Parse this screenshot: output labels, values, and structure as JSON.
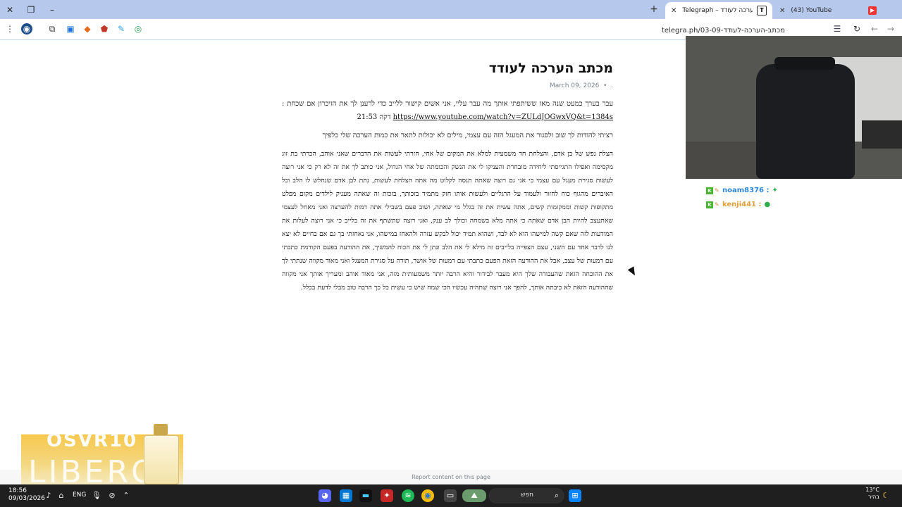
{
  "browser": {
    "tabs": [
      {
        "title": "Telegraph – מכתב הערכה לעודד",
        "favicon": "T",
        "active": true
      },
      {
        "title": "(43) YouTube",
        "favicon": "▶",
        "active": false
      }
    ],
    "url": "telegra.ph/03-09-מכתב-הערכה-לעודד",
    "new_tab": "+"
  },
  "article": {
    "title": "מכתב הערכה לעודד",
    "date": "March 09, 2026",
    "p1_text": "עבר בערך כמעט שנה מאז ששיתפתי אותך מה עבר עליי, אני אשים קישור ללייב כדי לרענן לך את הזיכרון אם שכחת :",
    "p1_link": "https://www.youtube.com/watch?v=ZULdJOGwxVQ&t=1384s",
    "p1_tail": "דקה 21:53",
    "p2": "רציתי להודות לך שוב ולסגור את המעגל הזה עם עצמי, מילים לא יכולות לתאר את כמות הערכה שלי כלפיך",
    "p3": "הצלת נפש של בן אדם, והצלחת חד משמעית למלא את המקום של אחי, חזרתי לעשות את הדברים שאני אוהב, הכרתי בת זוג מקסימה ואפילו התגייסתי ליחידה מובחרת והעניקו לי את הנשק והכומתה של אחי הגדול, אני כותב לך את זה לא רק כי אני רוצה לעשות סגירת מעגל עם עצמי כי אני גם רוצה שאתה תנסה לקלוט מה אתה הצלחת לעשות, נתת לבן אדם שנחלש לו הלב וכל האיברים מהגוף כוח לחזור ולעמוד על הרגליים ולעשות אותו חזק מתמיד בזכותך, בזכות זה שאתה מעניק לילדים מקום מפלט מתקופות קשות וממקומות קשים, אתה עשית את זה בגלל מי שאתה, ושוב פעם בשבילי אתה דמות להערצה ואני מאחל לעצמי שאתעצב להיות הבן אדם שאתה כי אתה מלא בשמחה וכולך לב ענק, ואני רוצה שתשתף את זה בלייב כי אני רוצה לעלות את המודעות לזה שאם קשה למישהו הוא לא לבד, ושהוא תמיד יכול לבקש עזרה ולהאחז במישהו, אני נאחזתי בך גם אם בחיים לא יצא לנו לדבר אחד עם השני, עצם הצפייה בלייבים זה מילא לי את הלב ונתן לי את הכוח להמשיך, את ההודעה בפעם הקודמת כתבתי עם דמעות של עצב, אבל את ההודעה הזאת הפעם כתבתי עם דמעות של אושר, תודה על סגירת המעגל ואני מאוד מקווה שנתתי לך את ההוכחה הזאת שהעבודה שלך היא מעבר לבידור והיא הרבה יותר משמעותית מזה, אני מאוד אוהב ומעריך אותך אני מקווה שההודעה הזאת לא כיבתה אותך, להפך אני רוצה שתהיה עכשיו הכי שמח שיש כי עשית כל כך הרבה טוב מבלי לדעת בכלל.",
    "report": "Report content on this page"
  },
  "chat": [
    {
      "name": "noam8376 :",
      "color": "#2f86d6"
    },
    {
      "name": "kenji441 :",
      "color": "#e0a13a"
    }
  ],
  "promo": {
    "code": "OSVR10",
    "brand": "LIBERO"
  },
  "taskbar": {
    "time": "18:56",
    "date": "09/03/2026",
    "lang": "ENG",
    "search_placeholder": "חפש",
    "temp": "13°C",
    "weather_label": "בהיר"
  }
}
